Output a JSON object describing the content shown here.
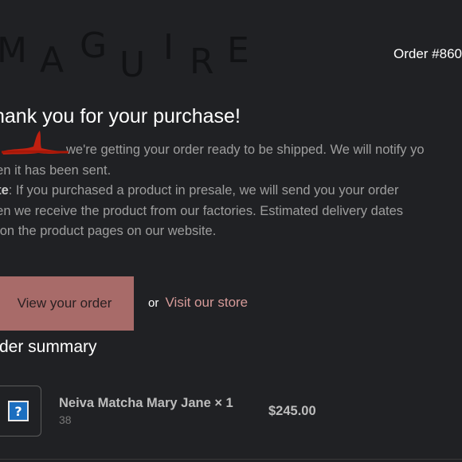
{
  "brand": {
    "logo_letters": [
      "M",
      "A",
      "G",
      "U",
      "I",
      "R",
      "E"
    ]
  },
  "header": {
    "order_number": "Order #860"
  },
  "main": {
    "headline": "hank you for your purchase!",
    "line1": "we're getting your order ready to be shipped. We will notify yo",
    "line2": "hen it has been sent.",
    "note_label": "ote",
    "line3": ": If you purchased a product in presale, we will send you your order",
    "line4": "hen we receive the product from our factories. Estimated delivery dates",
    "line5": "e on the product pages on our website."
  },
  "actions": {
    "view_order_label": "View your order",
    "or_text": "or",
    "visit_store_label": "Visit our store"
  },
  "summary": {
    "title": "rder summary",
    "items": [
      {
        "icon": "missing-image-icon",
        "name": "Neiva Matcha Mary Jane × 1",
        "variant": "38",
        "price": "$245.00"
      }
    ]
  },
  "colors": {
    "background": "#202124",
    "button": "#a86b69",
    "link": "#d69b99",
    "redaction": "#c02010"
  }
}
